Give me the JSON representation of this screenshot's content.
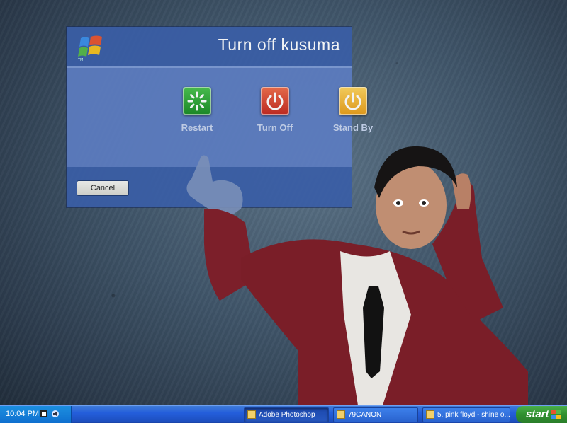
{
  "dialog": {
    "title": "Turn off kusuma",
    "options": {
      "restart": {
        "label": "Restart",
        "icon": "restart-icon",
        "color": "#2e9f35"
      },
      "turn_off": {
        "label": "Turn Off",
        "icon": "power-icon",
        "color": "#d83a24"
      },
      "stand_by": {
        "label": "Stand By",
        "icon": "power-icon",
        "color": "#f2a91f"
      }
    },
    "cancel_label": "Cancel"
  },
  "taskbar": {
    "clock": "10:04 PM",
    "tasks": [
      {
        "label": "Adobe Photoshop",
        "active": true
      },
      {
        "label": "79CANON",
        "active": false
      },
      {
        "label": "5. pink floyd - shine o...",
        "active": false
      }
    ],
    "start_label": "start"
  }
}
